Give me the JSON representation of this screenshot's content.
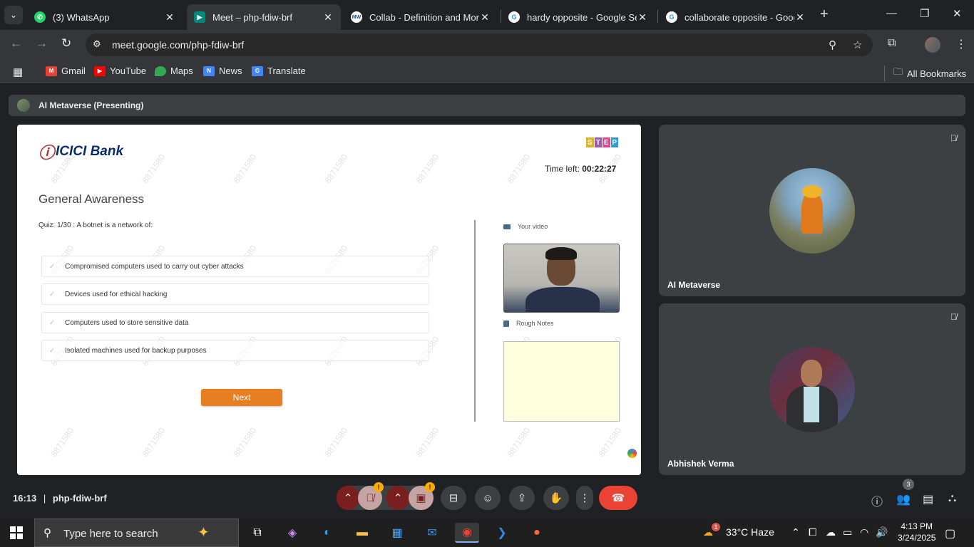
{
  "browser": {
    "tabs": [
      {
        "title": "(3) WhatsApp",
        "favicon": "whatsapp-icon",
        "active": false
      },
      {
        "title": "Meet – php-fdiw-brf",
        "favicon": "meet-icon",
        "active": true
      },
      {
        "title": "Collab - Definition and More",
        "favicon": "merriam-webster-icon",
        "active": false
      },
      {
        "title": "hardy opposite - Google Sea",
        "favicon": "google-icon",
        "active": false
      },
      {
        "title": "collaborate opposite - Goog",
        "favicon": "google-icon",
        "active": false
      }
    ],
    "url": "meet.google.com/php-fdiw-brf",
    "bookmarks": [
      {
        "label": "Gmail",
        "color": "#ea4335"
      },
      {
        "label": "YouTube",
        "color": "#ff0000"
      },
      {
        "label": "Maps",
        "color": "#34a853"
      },
      {
        "label": "News",
        "color": "#4285f4"
      },
      {
        "label": "Translate",
        "color": "#4285f4"
      }
    ],
    "all_bookmarks": "All Bookmarks"
  },
  "meet": {
    "presenting": "AI Metaverse (Presenting)",
    "meeting_time": "16:13",
    "meeting_code": "php-fdiw-brf",
    "participant_count": "3",
    "participants": [
      {
        "name": "AI Metaverse"
      },
      {
        "name": "Abhishek Verma"
      }
    ],
    "alert_badge": "!"
  },
  "quiz": {
    "bank_name": "ICICI Bank",
    "step_letters": [
      "S",
      "T",
      "E",
      "P"
    ],
    "step_colors": [
      "#e1b12c",
      "#9b59b6",
      "#e84393",
      "#3498db"
    ],
    "time_left_label": "Time left:",
    "time_left_value": "00:22:27",
    "section_title": "General Awareness",
    "question": "Quiz: 1/30 : A botnet is a network of:",
    "options": [
      "Compromised computers used to carry out cyber attacks",
      "Devices used for ethical hacking",
      "Computers used to store sensitive data",
      "Isolated machines used for backup purposes"
    ],
    "next_label": "Next",
    "your_video_label": "Your video",
    "rough_notes_label": "Rough Notes",
    "watermark": "8871580"
  },
  "taskbar": {
    "search_placeholder": "Type here to search",
    "weather": "33°C  Haze",
    "weather_badge": "1",
    "time": "4:13 PM",
    "date": "3/24/2025"
  }
}
